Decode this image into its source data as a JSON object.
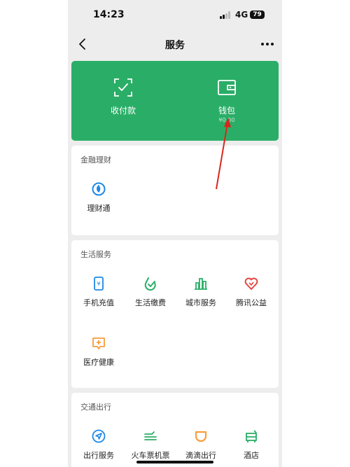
{
  "status_bar": {
    "time": "14:23",
    "network": "4G",
    "battery": "79"
  },
  "nav": {
    "title": "服务"
  },
  "wallet_panel": {
    "collect_label": "收付款",
    "wallet_label": "钱包",
    "wallet_balance": "¥0.00"
  },
  "sections": {
    "finance": {
      "title": "金融理财",
      "items": [
        {
          "label": "理财通",
          "icon": "licaitong-icon"
        }
      ]
    },
    "life": {
      "title": "生活服务",
      "items": [
        {
          "label": "手机充值",
          "icon": "phone-recharge-icon"
        },
        {
          "label": "生活缴费",
          "icon": "life-payment-icon"
        },
        {
          "label": "城市服务",
          "icon": "city-service-icon"
        },
        {
          "label": "腾讯公益",
          "icon": "tencent-charity-icon"
        },
        {
          "label": "医疗健康",
          "icon": "medical-health-icon"
        }
      ]
    },
    "travel": {
      "title": "交通出行",
      "items": [
        {
          "label": "出行服务",
          "icon": "travel-service-icon"
        },
        {
          "label": "火车票机票",
          "icon": "train-flight-icon"
        },
        {
          "label": "滴滴出行",
          "icon": "didi-icon"
        },
        {
          "label": "酒店",
          "icon": "hotel-icon"
        }
      ]
    }
  },
  "colors": {
    "panel_green": "#2aae67",
    "icon_blue": "#1e88e5",
    "icon_green": "#2aae67",
    "icon_red": "#e64340",
    "icon_orange": "#fa9d3b",
    "annotation_arrow": "#d9261c"
  }
}
